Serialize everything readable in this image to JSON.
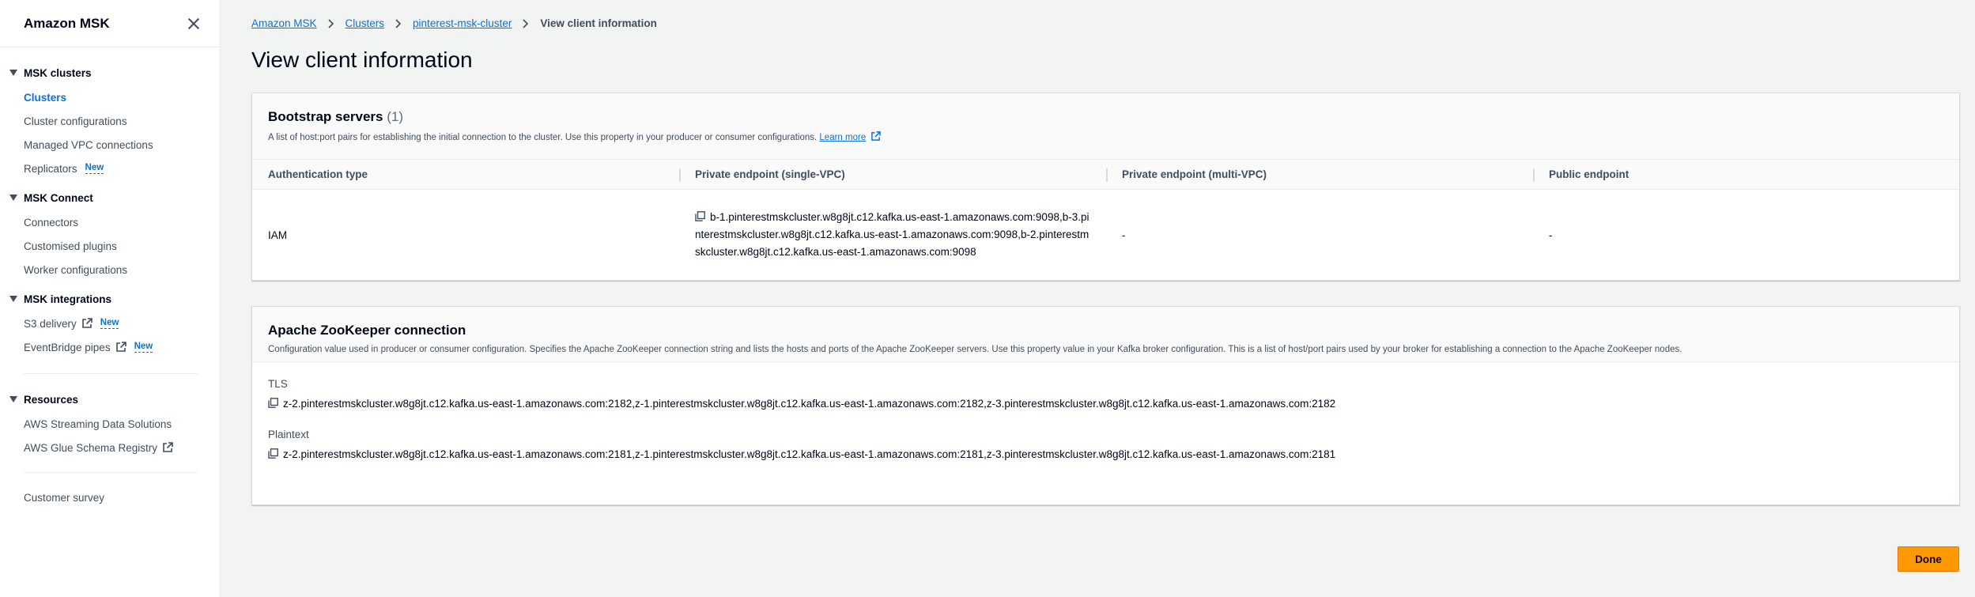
{
  "sidebar": {
    "title": "Amazon MSK",
    "groups": [
      {
        "title": "MSK clusters",
        "items": [
          {
            "label": "Clusters"
          },
          {
            "label": "Cluster configurations"
          },
          {
            "label": "Managed VPC connections"
          },
          {
            "label": "Replicators",
            "badge": "New"
          }
        ]
      },
      {
        "title": "MSK Connect",
        "items": [
          {
            "label": "Connectors"
          },
          {
            "label": "Customised plugins"
          },
          {
            "label": "Worker configurations"
          }
        ]
      },
      {
        "title": "MSK integrations",
        "items": [
          {
            "label": "S3 delivery",
            "badge": "New"
          },
          {
            "label": "EventBridge pipes",
            "badge": "New"
          }
        ]
      },
      {
        "title": "Resources",
        "items": [
          {
            "label": "AWS Streaming Data Solutions"
          },
          {
            "label": "AWS Glue Schema Registry"
          }
        ]
      }
    ],
    "footer_item": "Customer survey"
  },
  "breadcrumb": {
    "items": [
      "Amazon MSK",
      "Clusters",
      "pinterest-msk-cluster"
    ],
    "current": "View client information"
  },
  "page_title": "View client information",
  "bootstrap": {
    "title": "Bootstrap servers",
    "count": "(1)",
    "description": "A list of host:port pairs for establishing the initial connection to the cluster. Use this property in your producer or consumer configurations.",
    "learn_more": "Learn more",
    "columns": [
      "Authentication type",
      "Private endpoint (single-VPC)",
      "Private endpoint (multi-VPC)",
      "Public endpoint"
    ],
    "row": {
      "auth_type": "IAM",
      "private_single": "b-1.pinterestmskcluster.w8g8jt.c12.kafka.us-east-1.amazonaws.com:9098,b-3.pinterestmskcluster.w8g8jt.c12.kafka.us-east-1.amazonaws.com:9098,b-2.pinterestmskcluster.w8g8jt.c12.kafka.us-east-1.amazonaws.com:9098",
      "private_multi": "-",
      "public": "-"
    }
  },
  "zookeeper": {
    "title": "Apache ZooKeeper connection",
    "description": "Configuration value used in producer or consumer configuration. Specifies the Apache ZooKeeper connection string and lists the hosts and ports of the Apache ZooKeeper servers. Use this property value in your Kafka broker configuration. This is a list of host/port pairs used by your broker for establishing a connection to the Apache ZooKeeper nodes.",
    "tls_label": "TLS",
    "tls_value": "z-2.pinterestmskcluster.w8g8jt.c12.kafka.us-east-1.amazonaws.com:2182,z-1.pinterestmskcluster.w8g8jt.c12.kafka.us-east-1.amazonaws.com:2182,z-3.pinterestmskcluster.w8g8jt.c12.kafka.us-east-1.amazonaws.com:2182",
    "plaintext_label": "Plaintext",
    "plaintext_value": "z-2.pinterestmskcluster.w8g8jt.c12.kafka.us-east-1.amazonaws.com:2181,z-1.pinterestmskcluster.w8g8jt.c12.kafka.us-east-1.amazonaws.com:2181,z-3.pinterestmskcluster.w8g8jt.c12.kafka.us-east-1.amazonaws.com:2181"
  },
  "done_label": "Done",
  "colors": {
    "accent": "#0972d3",
    "primary_button": "#ff9900",
    "page_bg": "#f2f3f3"
  }
}
